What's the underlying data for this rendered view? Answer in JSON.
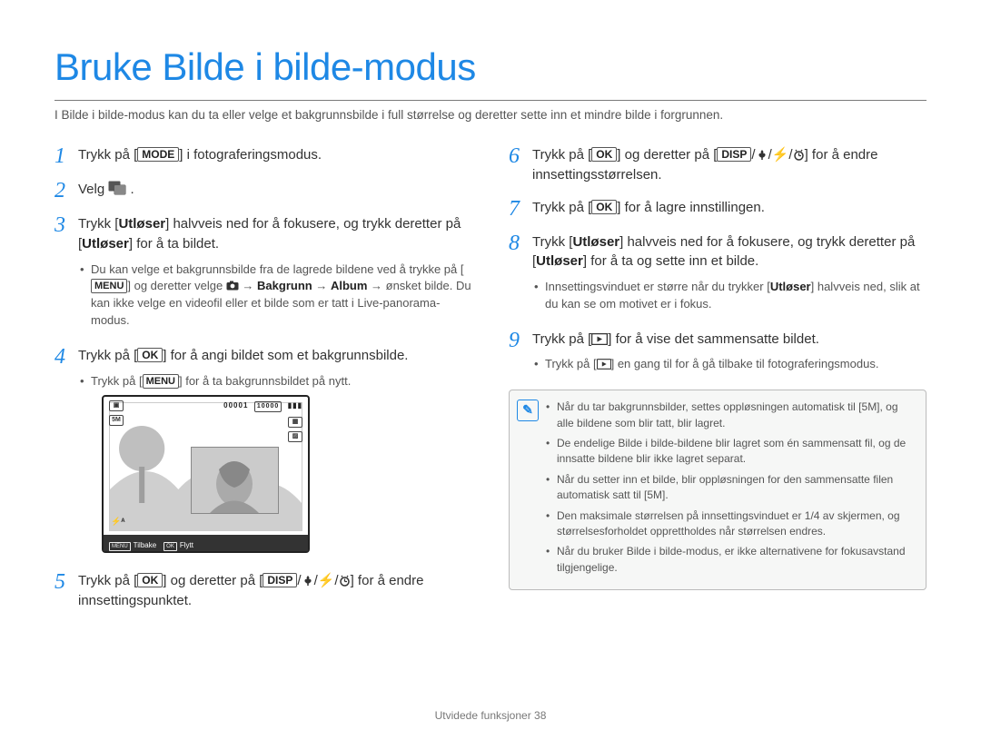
{
  "title": "Bruke Bilde i bilde-modus",
  "intro": "I Bilde i bilde-modus kan du ta eller velge et bakgrunnsbilde i full størrelse og deretter sette inn et mindre bilde i forgrunnen.",
  "btn": {
    "mode": "MODE",
    "ok": "OK",
    "menu": "MENU",
    "disp": "DISP"
  },
  "labels": {
    "utloser": "Utløser",
    "bakgrunn": "Bakgrunn",
    "album": "Album"
  },
  "left": {
    "s1_a": "Trykk på [",
    "s1_b": "] i fotograferingsmodus.",
    "s2_a": "Velg ",
    "s2_b": ".",
    "s3_a": "Trykk [",
    "s3_b": "] halvveis ned for å fokusere, og trykk deretter på [",
    "s3_c": "] for å ta bildet.",
    "s3_sub_a": "Du kan velge et bakgrunnsbilde fra de lagrede bildene ved å trykke på [",
    "s3_sub_b": "] og deretter velge ",
    "s3_sub_c": " → ",
    "s3_sub_d": " → ønsket bilde. Du kan ikke velge en videofil eller et bilde som er tatt i Live-panorama-modus.",
    "s4_a": "Trykk på [",
    "s4_b": "] for å angi bildet som et bakgrunnsbilde.",
    "s4_sub_a": "Trykk på [",
    "s4_sub_b": "] for å ta bakgrunnsbildet på nytt.",
    "s5_a": "Trykk på [",
    "s5_b": "] og deretter på [",
    "s5_c": "] for å endre innsettingspunktet."
  },
  "screen": {
    "counter": "00001",
    "iso": "10000",
    "tilbake": "Tilbake",
    "flytt": "Flytt"
  },
  "right": {
    "s6_a": "Trykk på [",
    "s6_b": "] og deretter på [",
    "s6_c": "] for å endre innsettingsstørrelsen.",
    "s7_a": "Trykk på [",
    "s7_b": "] for å lagre innstillingen.",
    "s8_a": "Trykk [",
    "s8_b": "] halvveis ned for å fokusere, og trykk deretter på [",
    "s8_c": "] for å ta og sette inn et bilde.",
    "s8_sub_a": "Innsettingsvinduet er større når du trykker [",
    "s8_sub_b": "] halvveis ned, slik at du kan se om motivet er i fokus.",
    "s9_a": "Trykk på [",
    "s9_b": "] for å vise det sammensatte bildet.",
    "s9_sub_a": "Trykk på [",
    "s9_sub_b": "] en gang til for å gå tilbake til fotograferingsmodus."
  },
  "notes": [
    "Når du tar bakgrunnsbilder, settes oppløsningen automatisk til [5M], og alle bildene som blir tatt, blir lagret.",
    "De endelige Bilde i bilde-bildene blir lagret som én sammensatt fil, og de innsatte bildene blir ikke lagret separat.",
    "Når du setter inn et bilde, blir oppløsningen for den sammensatte filen automatisk satt til [5M].",
    "Den maksimale størrelsen på innsettingsvinduet er 1/4 av skjermen, og størrelsesforholdet opprettholdes når størrelsen endres.",
    "Når du bruker Bilde i bilde-modus, er ikke alternativene for fokusavstand tilgjengelige."
  ],
  "footer": "Utvidede funksjoner  38"
}
